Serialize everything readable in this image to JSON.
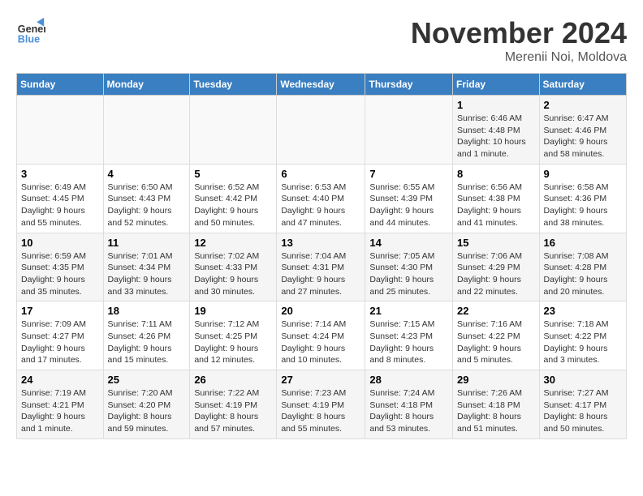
{
  "logo": {
    "line1": "General",
    "line2": "Blue"
  },
  "title": "November 2024",
  "subtitle": "Merenii Noi, Moldova",
  "weekdays": [
    "Sunday",
    "Monday",
    "Tuesday",
    "Wednesday",
    "Thursday",
    "Friday",
    "Saturday"
  ],
  "weeks": [
    [
      {
        "day": "",
        "info": ""
      },
      {
        "day": "",
        "info": ""
      },
      {
        "day": "",
        "info": ""
      },
      {
        "day": "",
        "info": ""
      },
      {
        "day": "",
        "info": ""
      },
      {
        "day": "1",
        "info": "Sunrise: 6:46 AM\nSunset: 4:48 PM\nDaylight: 10 hours and 1 minute."
      },
      {
        "day": "2",
        "info": "Sunrise: 6:47 AM\nSunset: 4:46 PM\nDaylight: 9 hours and 58 minutes."
      }
    ],
    [
      {
        "day": "3",
        "info": "Sunrise: 6:49 AM\nSunset: 4:45 PM\nDaylight: 9 hours and 55 minutes."
      },
      {
        "day": "4",
        "info": "Sunrise: 6:50 AM\nSunset: 4:43 PM\nDaylight: 9 hours and 52 minutes."
      },
      {
        "day": "5",
        "info": "Sunrise: 6:52 AM\nSunset: 4:42 PM\nDaylight: 9 hours and 50 minutes."
      },
      {
        "day": "6",
        "info": "Sunrise: 6:53 AM\nSunset: 4:40 PM\nDaylight: 9 hours and 47 minutes."
      },
      {
        "day": "7",
        "info": "Sunrise: 6:55 AM\nSunset: 4:39 PM\nDaylight: 9 hours and 44 minutes."
      },
      {
        "day": "8",
        "info": "Sunrise: 6:56 AM\nSunset: 4:38 PM\nDaylight: 9 hours and 41 minutes."
      },
      {
        "day": "9",
        "info": "Sunrise: 6:58 AM\nSunset: 4:36 PM\nDaylight: 9 hours and 38 minutes."
      }
    ],
    [
      {
        "day": "10",
        "info": "Sunrise: 6:59 AM\nSunset: 4:35 PM\nDaylight: 9 hours and 35 minutes."
      },
      {
        "day": "11",
        "info": "Sunrise: 7:01 AM\nSunset: 4:34 PM\nDaylight: 9 hours and 33 minutes."
      },
      {
        "day": "12",
        "info": "Sunrise: 7:02 AM\nSunset: 4:33 PM\nDaylight: 9 hours and 30 minutes."
      },
      {
        "day": "13",
        "info": "Sunrise: 7:04 AM\nSunset: 4:31 PM\nDaylight: 9 hours and 27 minutes."
      },
      {
        "day": "14",
        "info": "Sunrise: 7:05 AM\nSunset: 4:30 PM\nDaylight: 9 hours and 25 minutes."
      },
      {
        "day": "15",
        "info": "Sunrise: 7:06 AM\nSunset: 4:29 PM\nDaylight: 9 hours and 22 minutes."
      },
      {
        "day": "16",
        "info": "Sunrise: 7:08 AM\nSunset: 4:28 PM\nDaylight: 9 hours and 20 minutes."
      }
    ],
    [
      {
        "day": "17",
        "info": "Sunrise: 7:09 AM\nSunset: 4:27 PM\nDaylight: 9 hours and 17 minutes."
      },
      {
        "day": "18",
        "info": "Sunrise: 7:11 AM\nSunset: 4:26 PM\nDaylight: 9 hours and 15 minutes."
      },
      {
        "day": "19",
        "info": "Sunrise: 7:12 AM\nSunset: 4:25 PM\nDaylight: 9 hours and 12 minutes."
      },
      {
        "day": "20",
        "info": "Sunrise: 7:14 AM\nSunset: 4:24 PM\nDaylight: 9 hours and 10 minutes."
      },
      {
        "day": "21",
        "info": "Sunrise: 7:15 AM\nSunset: 4:23 PM\nDaylight: 9 hours and 8 minutes."
      },
      {
        "day": "22",
        "info": "Sunrise: 7:16 AM\nSunset: 4:22 PM\nDaylight: 9 hours and 5 minutes."
      },
      {
        "day": "23",
        "info": "Sunrise: 7:18 AM\nSunset: 4:22 PM\nDaylight: 9 hours and 3 minutes."
      }
    ],
    [
      {
        "day": "24",
        "info": "Sunrise: 7:19 AM\nSunset: 4:21 PM\nDaylight: 9 hours and 1 minute."
      },
      {
        "day": "25",
        "info": "Sunrise: 7:20 AM\nSunset: 4:20 PM\nDaylight: 8 hours and 59 minutes."
      },
      {
        "day": "26",
        "info": "Sunrise: 7:22 AM\nSunset: 4:19 PM\nDaylight: 8 hours and 57 minutes."
      },
      {
        "day": "27",
        "info": "Sunrise: 7:23 AM\nSunset: 4:19 PM\nDaylight: 8 hours and 55 minutes."
      },
      {
        "day": "28",
        "info": "Sunrise: 7:24 AM\nSunset: 4:18 PM\nDaylight: 8 hours and 53 minutes."
      },
      {
        "day": "29",
        "info": "Sunrise: 7:26 AM\nSunset: 4:18 PM\nDaylight: 8 hours and 51 minutes."
      },
      {
        "day": "30",
        "info": "Sunrise: 7:27 AM\nSunset: 4:17 PM\nDaylight: 8 hours and 50 minutes."
      }
    ]
  ]
}
